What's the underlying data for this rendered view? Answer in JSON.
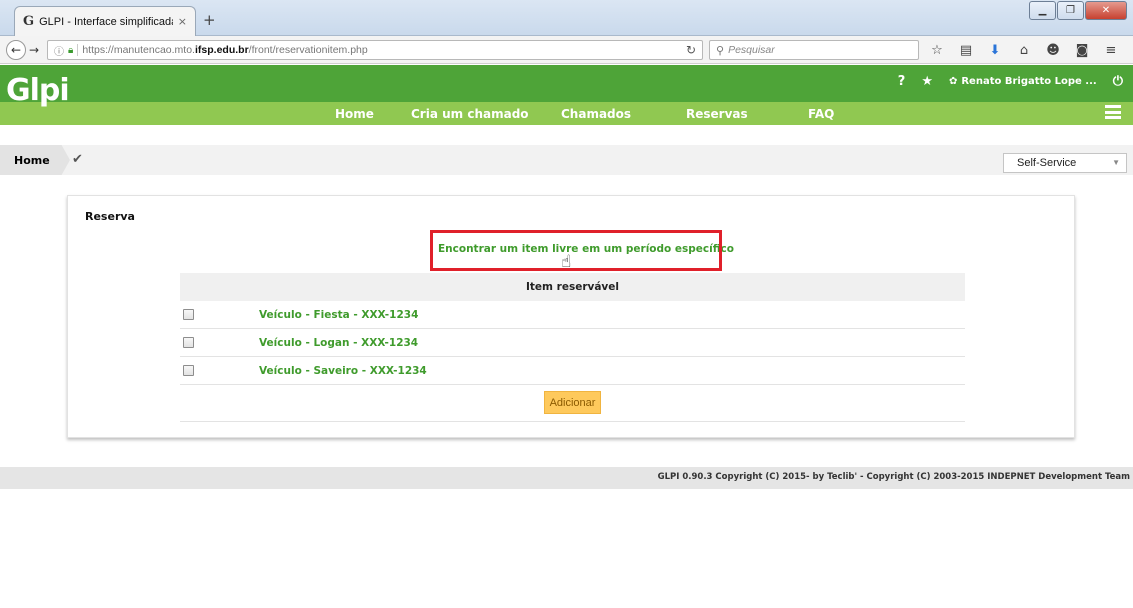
{
  "browser": {
    "tab_title": "GLPI - Interface simplificada",
    "tab_favicon": "G",
    "tab_close": "×",
    "new_tab": "+",
    "url_prefix": "https://manutencao.mto.",
    "url_domain": "ifsp.edu.br",
    "url_path": "/front/reservationitem.php",
    "search_placeholder": "Pesquisar",
    "icons": [
      "back-icon",
      "forward-icon",
      "info-icon",
      "lock-icon",
      "reload-icon",
      "search-icon",
      "star-icon",
      "reading-list-icon",
      "download-icon",
      "home-icon",
      "chat-icon",
      "pocket-icon",
      "menu-icon"
    ]
  },
  "header": {
    "logo": "Glpi",
    "help_icon": "?",
    "favorite_icon": "★",
    "user_name": "Renato Brigatto Lope ...",
    "gear_icon": "✿",
    "logout_icon": "⏻",
    "menu": [
      {
        "label": "Home"
      },
      {
        "label": "Cria um chamado"
      },
      {
        "label": "Chamados"
      },
      {
        "label": "Reservas"
      },
      {
        "label": "FAQ"
      }
    ],
    "colors": {
      "top": "#4ea438",
      "menu": "#90c851"
    }
  },
  "breadcrumb": {
    "home": "Home",
    "reservation_icon": "✔",
    "profile": "Self-Service",
    "profile_arrow": "▼"
  },
  "panel": {
    "title": "Reserva",
    "find_link": "Encontrar um item livre em um período específico",
    "table_header": "Item reservável",
    "items": [
      {
        "label": "Veículo - Fiesta - XXX-1234"
      },
      {
        "label": "Veículo - Logan - XXX-1234"
      },
      {
        "label": "Veículo - Saveiro - XXX-1234"
      }
    ],
    "add_button": "Adicionar",
    "cursor": "☝"
  },
  "footer": {
    "text": "GLPI 0.90.3 Copyright (C) 2015- by Teclib' - Copyright (C) 2003-2015 INDEPNET Development Team"
  }
}
